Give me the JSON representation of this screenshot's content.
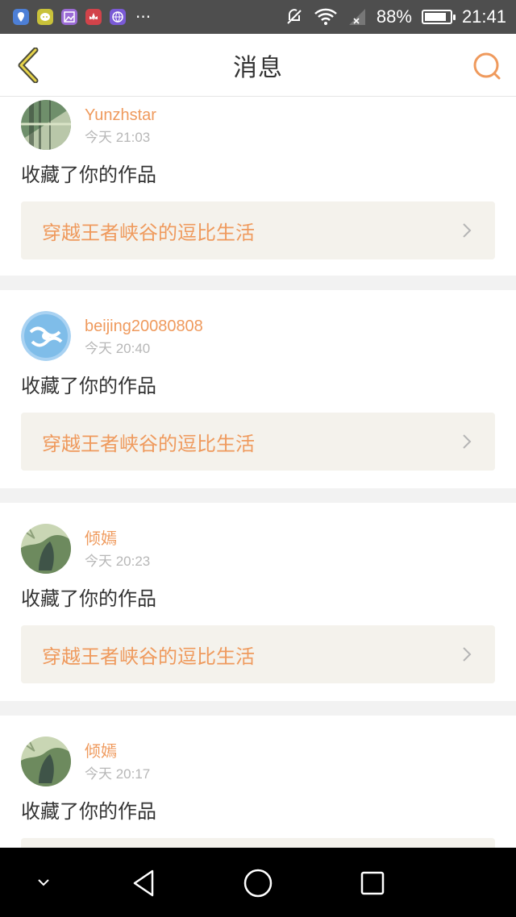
{
  "status_bar": {
    "app_icons": [
      {
        "name": "maps-app-icon",
        "color": "#4d7fd6"
      },
      {
        "name": "chat-app-icon",
        "color": "#c9c23a"
      },
      {
        "name": "gallery-app-icon",
        "color": "#9b6bd6"
      },
      {
        "name": "huawei-app-icon",
        "color": "#d2434a"
      },
      {
        "name": "browser-app-icon",
        "color": "#7a5ad6"
      }
    ],
    "more_indicator": "···",
    "battery_percent": "88%",
    "battery_level": 0.88,
    "time": "21:41"
  },
  "header": {
    "title": "消息",
    "back_icon": "chevron-left-icon",
    "search_icon": "search-icon",
    "accent_color": "#ef9a5d"
  },
  "messages": [
    {
      "username": "Yunzhstar",
      "time": "今天 21:03",
      "action": "收藏了你的作品",
      "work_title": "穿越王者峡谷的逗比生活"
    },
    {
      "username": "beijing20080808",
      "time": "今天 20:40",
      "action": "收藏了你的作品",
      "work_title": "穿越王者峡谷的逗比生活"
    },
    {
      "username": "倾嫣",
      "time": "今天 20:23",
      "action": "收藏了你的作品",
      "work_title": "穿越王者峡谷的逗比生活"
    },
    {
      "username": "倾嫣",
      "time": "今天 20:17",
      "action": "收藏了你的作品",
      "work_title": ""
    }
  ],
  "nav_bar": {
    "icons": [
      "hide-nav-icon",
      "back-triangle-icon",
      "home-circle-icon",
      "recents-square-icon"
    ]
  }
}
